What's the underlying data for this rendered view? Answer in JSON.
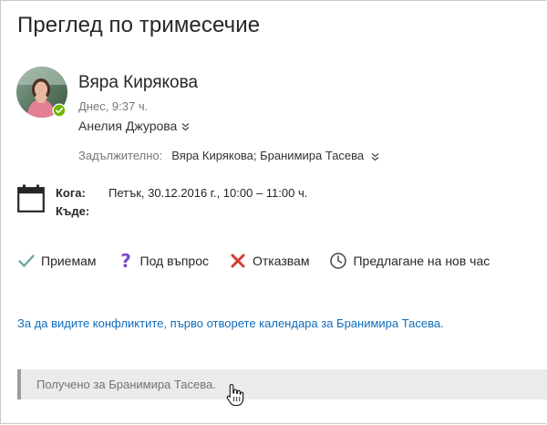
{
  "message": {
    "title": "Преглед по тримесечие",
    "sender": {
      "name": "Вяра Кирякова",
      "sent": "Днес, 9:37 ч.",
      "presence": "available"
    },
    "recipient": "Анелия Джурова",
    "required": {
      "label": "Задължително:",
      "value": "Вяра Кирякова; Бранимира Тасева"
    }
  },
  "meeting": {
    "when_label": "Кога:",
    "when_value": "Петък, 30.12.2016 г., 10:00 – 11:00 ч.",
    "where_label": "Къде:",
    "where_value": ""
  },
  "actions": [
    {
      "label": "Приемам",
      "icon": "check-icon",
      "color": "#6ea6a0"
    },
    {
      "label": "Под въпрос",
      "icon": "question-icon",
      "color": "#7b4ec9"
    },
    {
      "label": "Отказвам",
      "icon": "close-icon",
      "color": "#d63b2f"
    },
    {
      "label": "Предлагане на нов час",
      "icon": "clock-icon",
      "color": "#444444"
    }
  ],
  "conflict_link": "За да видите конфликтите, първо отворете календара за Бранимира Тасева.",
  "received_for": "Получено за Бранимира Тасева.",
  "colors": {
    "link": "#0f6cbd",
    "presence": "#6bb700",
    "bar": "#ebebeb",
    "bar_accent": "#9c9c9c"
  }
}
